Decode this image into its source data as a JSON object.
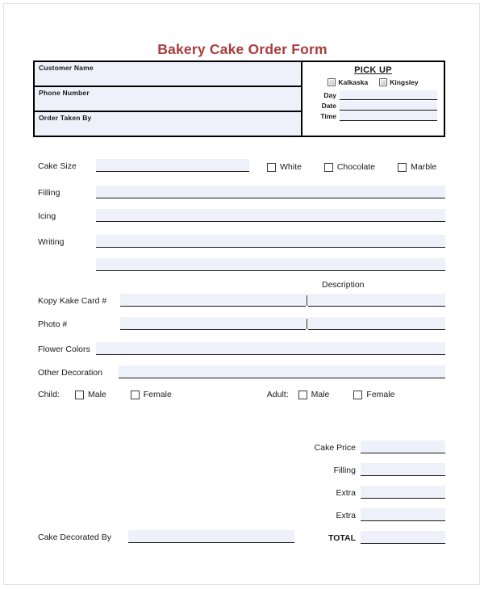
{
  "document": {
    "title": "Bakery Cake Order Form",
    "title_color": "#a93c3c",
    "line_fill_color": "#eef0fa"
  },
  "customer_block": {
    "rows": [
      {
        "label": "Customer Name"
      },
      {
        "label": "Phone Number"
      },
      {
        "label": "Order Taken By"
      }
    ]
  },
  "pickup_block": {
    "heading": "PICK UP",
    "locations": [
      {
        "label": "Kalkaska",
        "checked": false
      },
      {
        "label": "Kingsley",
        "checked": false
      }
    ],
    "fields": [
      {
        "label": "Day",
        "value": ""
      },
      {
        "label": "Date",
        "value": ""
      },
      {
        "label": "Time",
        "value": ""
      }
    ]
  },
  "order_details": {
    "cake_size": {
      "label": "Cake Size",
      "value": "",
      "flavors": [
        {
          "label": "White",
          "checked": false
        },
        {
          "label": "Chocolate",
          "checked": false
        },
        {
          "label": "Marble",
          "checked": false
        }
      ]
    },
    "filling": {
      "label": "Filling",
      "value": ""
    },
    "icing": {
      "label": "Icing",
      "value": ""
    },
    "writing": {
      "label": "Writing",
      "value": ""
    },
    "writing_continued": {
      "label": "",
      "value": ""
    }
  },
  "description_section": {
    "header": "Description",
    "rows": [
      {
        "label": "Kopy Kake Card #",
        "value": "",
        "description": ""
      },
      {
        "label": "Photo #",
        "value": "",
        "description": ""
      }
    ]
  },
  "decoration": {
    "flower_colors": {
      "label": "Flower Colors",
      "value": ""
    },
    "other_decoration": {
      "label": "Other Decoration",
      "value": ""
    }
  },
  "figures": {
    "child": {
      "label": "Child:",
      "options": [
        {
          "label": "Male",
          "checked": false
        },
        {
          "label": "Female",
          "checked": false
        }
      ]
    },
    "adult": {
      "label": "Adult:",
      "options": [
        {
          "label": "Male",
          "checked": false
        },
        {
          "label": "Female",
          "checked": false
        }
      ]
    }
  },
  "pricing": {
    "rows": [
      {
        "label": "Cake Price",
        "value": ""
      },
      {
        "label": "Filling",
        "value": ""
      },
      {
        "label": "Extra",
        "value": ""
      },
      {
        "label": "Extra",
        "value": ""
      }
    ],
    "total": {
      "label": "TOTAL",
      "value": ""
    }
  },
  "footer": {
    "decorated_by": {
      "label": "Cake Decorated By",
      "value": ""
    }
  }
}
